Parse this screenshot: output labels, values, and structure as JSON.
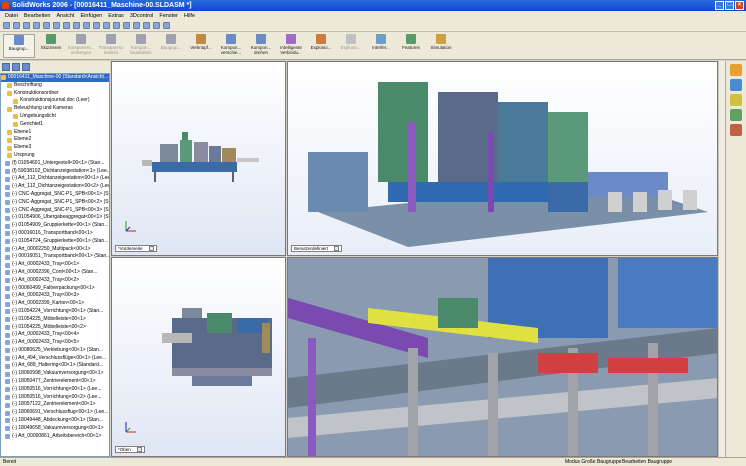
{
  "window": {
    "title": "SolidWorks 2006 - [00016411_Maschine-00.SLDASM *]"
  },
  "menu": [
    "Datei",
    "Bearbeiten",
    "Ansicht",
    "Einfügen",
    "Extras",
    "3Dcontrol",
    "Fenster",
    "Hilfe"
  ],
  "toolbar": {
    "tools": [
      {
        "label": "Baugrup...",
        "enabled": true
      },
      {
        "label": "Skizzieren",
        "enabled": true
      },
      {
        "label": "Komponent... verbergen",
        "enabled": false
      },
      {
        "label": "Transparenz ändern",
        "enabled": false
      },
      {
        "label": "Kompon... bearbeiten",
        "enabled": false
      },
      {
        "label": "Baugrup...",
        "enabled": false
      },
      {
        "label": "Verknüpf...",
        "enabled": true
      },
      {
        "label": "Kompon... verschie...",
        "enabled": true
      },
      {
        "label": "Kompon... drehen",
        "enabled": true
      },
      {
        "label": "Intelligente Verbindu...",
        "enabled": true
      },
      {
        "label": "Explosio...",
        "enabled": true
      },
      {
        "label": "Explosio...",
        "enabled": false
      },
      {
        "label": "Interfer...",
        "enabled": true
      },
      {
        "label": "Features",
        "enabled": true
      },
      {
        "label": "Simulation",
        "enabled": true
      }
    ]
  },
  "tree": {
    "root": "00016411_Maschine-00 (Standard<Ansicht...",
    "items": [
      "Beschriftung",
      "Konstruktionsordner",
      "Konstruktionsjournal.doc (Leer)",
      "Beleuchtung und Kameras",
      "Umgebungslicht",
      "Gerichtet1",
      "Ebene1",
      "Ebene2",
      "Ebene3",
      "Ursprung",
      "(f) 01054601_Untergestell<00<1> (Stan...",
      "(f) 59038102_Dichtanzeigestation<1> (Lee...",
      "(-) Art_112_Dichtanzeigestation<00<1> (Lee...",
      "(-) Art_112_Dichtanzeigestation<00<2> (Lee...",
      "(-) CNC-Aggregat_SNC-P1_SPB<00<1> (Stan...",
      "(-) CNC-Aggregat_SNC-P1_SPB<00<2> (Stan...",
      "(-) CNC-Aggregat_SNC-P1_SPB<00<3> (Stan...",
      "(-) 01054906_Übergabeaggregat<00<1> (Sta...",
      "(-) 01054909_Gruppierkette<00<1> (Stan...",
      "(-) 00016016_Transportband<00<1>",
      "(-) 01054724_Gruppierkette<00<1> (Stan...",
      "(-) Art_00002250_Multipack<00<1>",
      "(-) 00016051_Transportband<00<1> (Stan...",
      "(-) Art_00002433_Tray<00<1>",
      "(-) Art_00002396_Cont<00<1> (Stan...",
      "(-) Art_00002433_Tray<00<2>",
      "(-) 00060499_Faltverpackung<00<1>",
      "(-) Art_00002433_Tray<00<3>",
      "(-) Art_00002399_Karton<00<1>",
      "(-) 01054224_Vorrichtung<00<1> (Stan...",
      "(-) 01054225_Möbelleiste<00<1>",
      "(-) 01054225_Möbelleiste<00<2>",
      "(-) Art_00002433_Tray<00<4>",
      "(-) Art_00002433_Tray<00<5>",
      "(-) 00080625_Verklebung<00<1> (Stan...",
      "(-) Art_494_Verschlussflüge<00<1> (Lee...",
      "(-) Art_688_Haltering<00<1> (Standard...",
      "(-) 18060998_Vakuumversorgung<00<1>",
      "(-) 18050477_Zentrierelement<00<1>",
      "(-) 18050516_Vorrichtung<00<1> (Lee...",
      "(-) 18050516_Vorrichtung<00<2> (Lee...",
      "(-) 18057122_Zentrierelement<00<1>",
      "(-) 18060691_Verschlussflug<00<1> (Lee...",
      "(-) 18049448_Abdeckung<00<1> (Stan...",
      "(-) 18049658_Vakuumversorgung<00<1>",
      "(-) Art_00000861_Arbeitsbereich<00<1>"
    ]
  },
  "viewports": {
    "top_left": {
      "label": "*Vorderseite"
    },
    "top_right": {
      "label": "Benutzerdefiniert"
    },
    "bottom_left": {
      "label": "*Oben"
    }
  },
  "status": {
    "left": "Bereit",
    "mode": "Modus Große Baugruppe",
    "edit": "Bearbeiten Baugruppe"
  }
}
